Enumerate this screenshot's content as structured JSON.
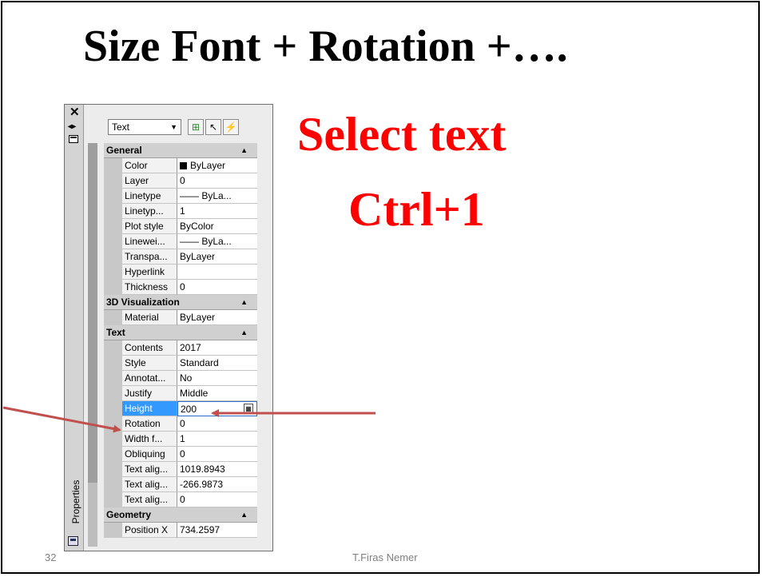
{
  "slide": {
    "title": "Size Font + Rotation +….",
    "callout_line1": "Select text",
    "callout_line2": "Ctrl+1",
    "page_number": "32",
    "author": "T.Firas Nemer",
    "accent_color": "#ff0000",
    "arrow_color": "#c0504d"
  },
  "palette": {
    "vertical_title": "Properties",
    "object_type": "Text",
    "categories": [
      {
        "label": "General",
        "rows": [
          {
            "name": "Color",
            "value": "ByLayer",
            "swatch": true
          },
          {
            "name": "Layer",
            "value": "0"
          },
          {
            "name": "Linetype",
            "value": "—— ByLa..."
          },
          {
            "name": "Linetyp...",
            "value": "1"
          },
          {
            "name": "Plot style",
            "value": "ByColor"
          },
          {
            "name": "Linewei...",
            "value": "—— ByLa..."
          },
          {
            "name": "Transpa...",
            "value": "ByLayer"
          },
          {
            "name": "Hyperlink",
            "value": ""
          },
          {
            "name": "Thickness",
            "value": "0"
          }
        ]
      },
      {
        "label": "3D Visualization",
        "rows": [
          {
            "name": "Material",
            "value": "ByLayer"
          }
        ]
      },
      {
        "label": "Text",
        "rows": [
          {
            "name": "Contents",
            "value": "2017"
          },
          {
            "name": "Style",
            "value": "Standard"
          },
          {
            "name": "Annotat...",
            "value": "No"
          },
          {
            "name": "Justify",
            "value": "Middle"
          },
          {
            "name": "Height",
            "value": "200",
            "selected": true
          },
          {
            "name": "Rotation",
            "value": "0"
          },
          {
            "name": "Width f...",
            "value": "1"
          },
          {
            "name": "Obliquing",
            "value": "0"
          },
          {
            "name": "Text alig...",
            "value": "1019.8943"
          },
          {
            "name": "Text alig...",
            "value": "-266.9873"
          },
          {
            "name": "Text alig...",
            "value": "0"
          }
        ]
      },
      {
        "label": "Geometry",
        "rows": [
          {
            "name": "Position X",
            "value": "734.2597"
          }
        ]
      }
    ]
  }
}
